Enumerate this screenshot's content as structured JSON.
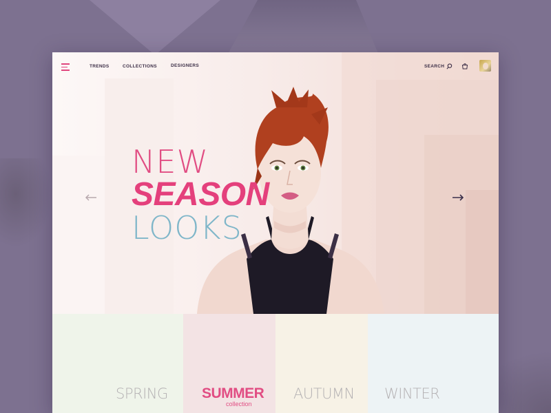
{
  "nav": {
    "links": [
      "TRENDS",
      "COLLECTIONS",
      "DESIGNERS"
    ],
    "search_label": "SEARCH"
  },
  "hero": {
    "line1": "NEW",
    "line2": "SEASON",
    "line3": "LOOKS"
  },
  "seasons": [
    {
      "name": "SPRING"
    },
    {
      "name": "SUMMER",
      "sub": "collection"
    },
    {
      "name": "AUTUMN"
    },
    {
      "name": "WINTER"
    }
  ],
  "colors": {
    "accent": "#e14d83",
    "looks": "#7fb6c9",
    "background": "#7d7190"
  },
  "icons": [
    "menu-icon",
    "search-icon",
    "cart-icon",
    "avatar",
    "arrow-left-icon",
    "arrow-right-icon"
  ]
}
